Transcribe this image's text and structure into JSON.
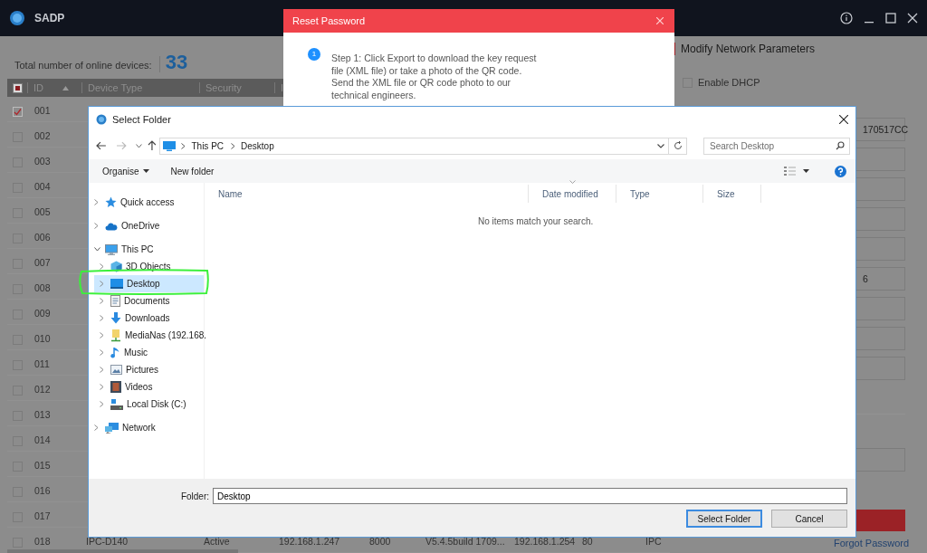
{
  "app": {
    "title": "SADP"
  },
  "summary": {
    "label": "Total number of online devices:",
    "count": "33"
  },
  "table": {
    "select_all_checked": true,
    "columns": [
      {
        "label": "ID",
        "sorted": true
      },
      {
        "label": "Device Type",
        "sorted": false
      },
      {
        "label": "Security",
        "sorted": false
      },
      {
        "label": "I",
        "sorted": false
      }
    ],
    "rows": [
      {
        "id": "001",
        "checked": true
      },
      {
        "id": "002",
        "checked": false
      },
      {
        "id": "003",
        "checked": false
      },
      {
        "id": "004",
        "checked": false
      },
      {
        "id": "005",
        "checked": false
      },
      {
        "id": "006",
        "checked": false
      },
      {
        "id": "007",
        "checked": false
      },
      {
        "id": "008",
        "checked": false
      },
      {
        "id": "009",
        "checked": false
      },
      {
        "id": "010",
        "checked": false
      },
      {
        "id": "011",
        "checked": false
      },
      {
        "id": "012",
        "checked": false
      },
      {
        "id": "013",
        "checked": false
      },
      {
        "id": "014",
        "checked": false
      },
      {
        "id": "015",
        "checked": false
      },
      {
        "id": "016",
        "checked": false
      },
      {
        "id": "017",
        "checked": false
      },
      {
        "id": "018",
        "checked": false,
        "cells": [
          "IPC-D140",
          "Active",
          "192.168.1.247",
          "8000",
          "V5.4.5build 1709...",
          "192.168.1.254",
          "80",
          "IPC"
        ]
      }
    ]
  },
  "right_panel": {
    "title": "Modify Network Parameters",
    "dhcp": {
      "label": "Enable DHCP",
      "checked": false
    },
    "fields": [
      {
        "kind": "filled",
        "value": "170517CC"
      },
      {
        "kind": "empty"
      },
      {
        "kind": "empty"
      },
      {
        "kind": "empty"
      },
      {
        "kind": "empty"
      },
      {
        "kind": "filled",
        "value": "6"
      },
      {
        "kind": "empty"
      },
      {
        "kind": "empty"
      },
      {
        "kind": "empty"
      }
    ],
    "forgot_link": "Forgot Password"
  },
  "reset_dialog": {
    "title": "Reset Password",
    "steps": [
      {
        "number": "1",
        "text": "Step 1: Click Export to download the key request file (XML file) or take a photo of the QR code. Send the XML file or QR code photo to our technical engineers."
      }
    ]
  },
  "folder_dialog": {
    "title": "Select Folder",
    "breadcrumb": [
      "This PC",
      "Desktop"
    ],
    "search": {
      "placeholder": "Search Desktop"
    },
    "toolbar": [
      {
        "label": "Organise",
        "dropdown": true
      },
      {
        "label": "New folder",
        "dropdown": false
      }
    ],
    "nav": [
      {
        "kind": "quick_access",
        "label": "Quick access",
        "expanded": false,
        "selected": false
      },
      {
        "kind": "onedrive",
        "label": "OneDrive",
        "expanded": false,
        "selected": false
      },
      {
        "kind": "this_pc",
        "label": "This PC",
        "expanded": true,
        "selected": false,
        "children": [
          {
            "kind": "objects_3d",
            "label": "3D Objects",
            "expanded": false,
            "selected": false
          },
          {
            "kind": "desktop",
            "label": "Desktop",
            "expanded": false,
            "selected": true,
            "circled": true
          },
          {
            "kind": "documents",
            "label": "Documents",
            "expanded": false,
            "selected": false
          },
          {
            "kind": "downloads",
            "label": "Downloads",
            "expanded": false,
            "selected": false
          },
          {
            "kind": "network_drive",
            "label": "MediaNas (192.168.",
            "expanded": false,
            "selected": false
          },
          {
            "kind": "music",
            "label": "Music",
            "expanded": false,
            "selected": false
          },
          {
            "kind": "pictures",
            "label": "Pictures",
            "expanded": false,
            "selected": false
          },
          {
            "kind": "videos",
            "label": "Videos",
            "expanded": false,
            "selected": false
          },
          {
            "kind": "local_disk",
            "label": "Local Disk (C:)",
            "expanded": false,
            "selected": false
          }
        ]
      },
      {
        "kind": "network",
        "label": "Network",
        "expanded": false,
        "selected": false
      }
    ],
    "columns": [
      {
        "label": "Name",
        "sorted": false
      },
      {
        "label": "Date modified",
        "sorted": true
      },
      {
        "label": "Type",
        "sorted": false
      },
      {
        "label": "Size",
        "sorted": false
      }
    ],
    "empty_message": "No items match your search.",
    "folder": {
      "label": "Folder:",
      "value": "Desktop"
    },
    "buttons": [
      {
        "label": "Select Folder",
        "default": true
      },
      {
        "label": "Cancel",
        "default": false
      }
    ]
  }
}
